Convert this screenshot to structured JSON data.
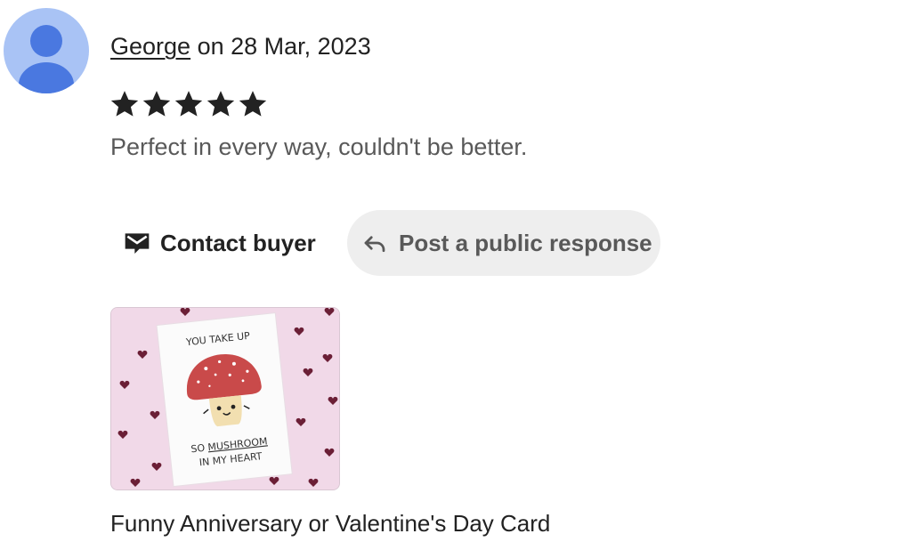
{
  "review": {
    "reviewer_name": "George",
    "date_text": " on 28 Mar, 2023",
    "rating": 5,
    "rating_max": 5,
    "text": "Perfect in every way, couldn't be better."
  },
  "actions": {
    "contact_label": "Contact buyer",
    "respond_label": "Post a public response"
  },
  "product": {
    "title": "Funny Anniversary or Valentine's Day Card",
    "card_line1": "YOU TAKE UP",
    "card_line2_prefix": "SO ",
    "card_line2_word": "MUSHROOM",
    "card_line3": "IN MY HEART"
  },
  "icons": {
    "avatar": "user-avatar-icon",
    "star": "star-icon",
    "contact": "envelope-message-icon",
    "respond": "reply-arrow-icon"
  },
  "colors": {
    "avatar_bg": "#a9c3f5",
    "avatar_fg": "#4a78e0",
    "star": "#222222",
    "respond_bg": "#eeeeee",
    "thumb_bg": "#f1d9e8",
    "mushroom_cap": "#c94a4a"
  }
}
